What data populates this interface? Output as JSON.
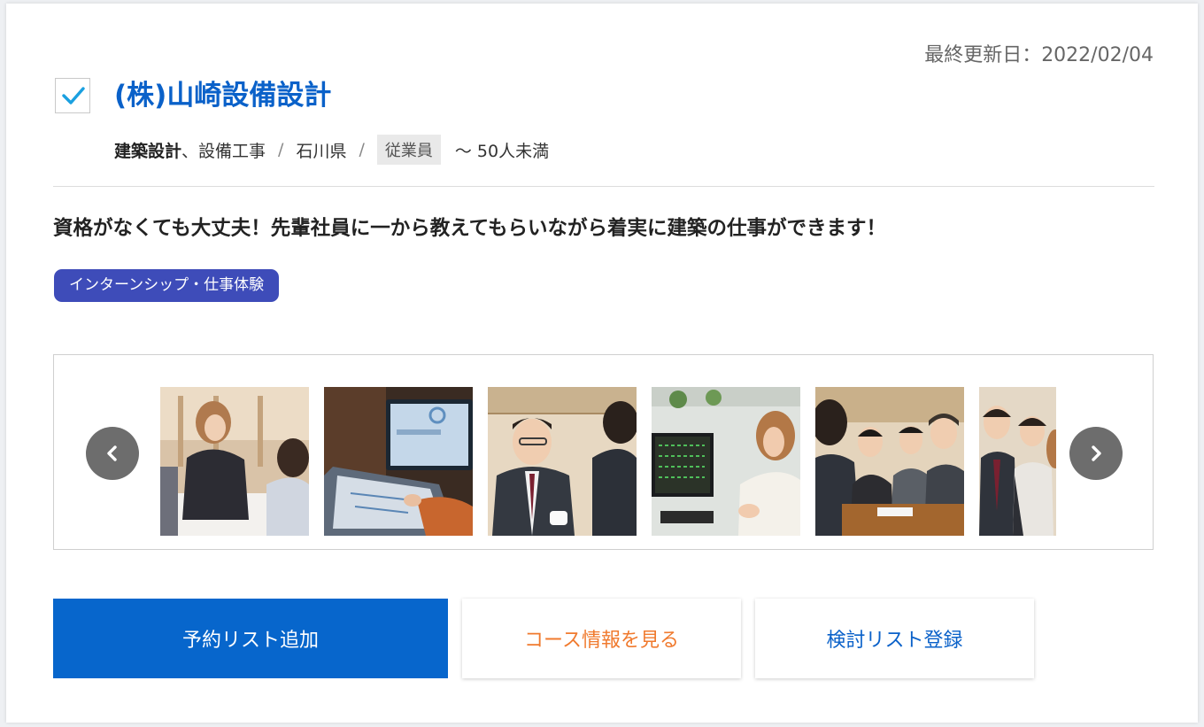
{
  "last_updated": "最終更新日：2022/02/04",
  "company": {
    "name": "(株)山崎設備設計",
    "selected": true
  },
  "meta": {
    "industry_main": "建築設計",
    "industry_sub": "、設備工事",
    "separator": "/",
    "location": "石川県",
    "employees_tag": "従業員",
    "employees_value": "～ 50人未満"
  },
  "headline": "資格がなくても大丈夫！先輩社員に一から教えてもらいながら着実に建築の仕事ができます！",
  "badge": "インターンシップ・仕事体験",
  "carousel": {
    "prev_icon": "chevron-left-icon",
    "next_icon": "chevron-right-icon",
    "photo_count": 6
  },
  "actions": {
    "reserve_label": "予約リスト追加",
    "course_label": "コース情報を見る",
    "consider_label": "検討リスト登録"
  },
  "colors": {
    "brand_blue": "#0a61c9",
    "primary_button": "#0766cc",
    "badge_bg": "#3e4cb9",
    "course_text": "#f07a2e",
    "check_mark": "#1aa0e0"
  }
}
